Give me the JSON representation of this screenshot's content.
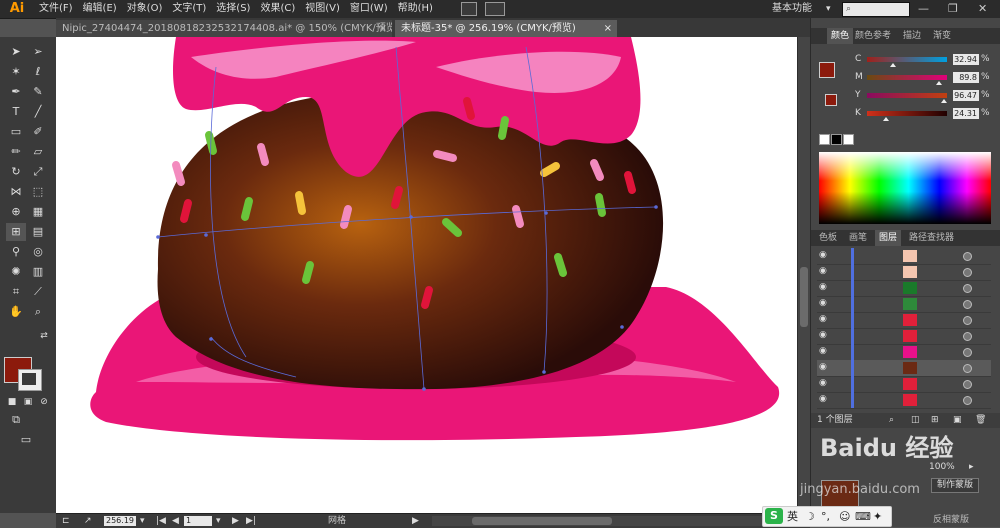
{
  "app": {
    "logo": "Ai"
  },
  "menu": [
    "文件(F)",
    "编辑(E)",
    "对象(O)",
    "文字(T)",
    "选择(S)",
    "效果(C)",
    "视图(V)",
    "窗口(W)",
    "帮助(H)"
  ],
  "workspace": {
    "label": "基本功能",
    "chevron": "▾"
  },
  "window_controls": {
    "minimize": "—",
    "restore": "❐",
    "close": "✕"
  },
  "tabs": [
    {
      "label": "Nipic_27404474_20180818232532174408.ai* @ 150% (CMYK/预览)",
      "close": "×"
    },
    {
      "label": "未标题-35* @ 256.19% (CMYK/预览)",
      "close": "×"
    }
  ],
  "status": {
    "zoom": "256.19",
    "page": "1",
    "tool_label": "网格"
  },
  "color_panel": {
    "tabs": [
      "颜色",
      "颜色参考",
      "描边",
      "渐变"
    ],
    "channels": [
      {
        "label": "C",
        "value": "32.94",
        "percent": 32.94,
        "color": "#00a0e0"
      },
      {
        "label": "M",
        "value": "89.8",
        "percent": 89.8,
        "color": "#e0007a"
      },
      {
        "label": "Y",
        "value": "96.47",
        "percent": 96.47,
        "color": "#f0e000"
      },
      {
        "label": "K",
        "value": "24.31",
        "percent": 24.31,
        "color": "#333333"
      }
    ],
    "unit": "%",
    "fill_color": "#8c1a0c"
  },
  "layers_panel": {
    "tabs": [
      "色板",
      "画笔",
      "图层",
      "路径查找器"
    ],
    "active_tab": "图层",
    "rows": [
      {
        "thumb": "#f5c6b0"
      },
      {
        "thumb": "#f5c6b0"
      },
      {
        "thumb": "#1a7a2a"
      },
      {
        "thumb": "#2e8a3a"
      },
      {
        "thumb": "#e0203a"
      },
      {
        "thumb": "#e0203a"
      },
      {
        "thumb": "#e8108a"
      },
      {
        "thumb": "#6b2a14"
      },
      {
        "thumb": "#e0203a"
      },
      {
        "thumb": "#e0203a"
      }
    ],
    "footer": "1 个图层"
  },
  "transparency": {
    "opacity": "100%",
    "make_mask": "制作蒙版",
    "invert_mask": "反相蒙版"
  },
  "ime": {
    "logo": "S",
    "lang": "英"
  },
  "watermark": {
    "brand": "Baidu 经验",
    "url": "jingyan.baidu.com"
  }
}
